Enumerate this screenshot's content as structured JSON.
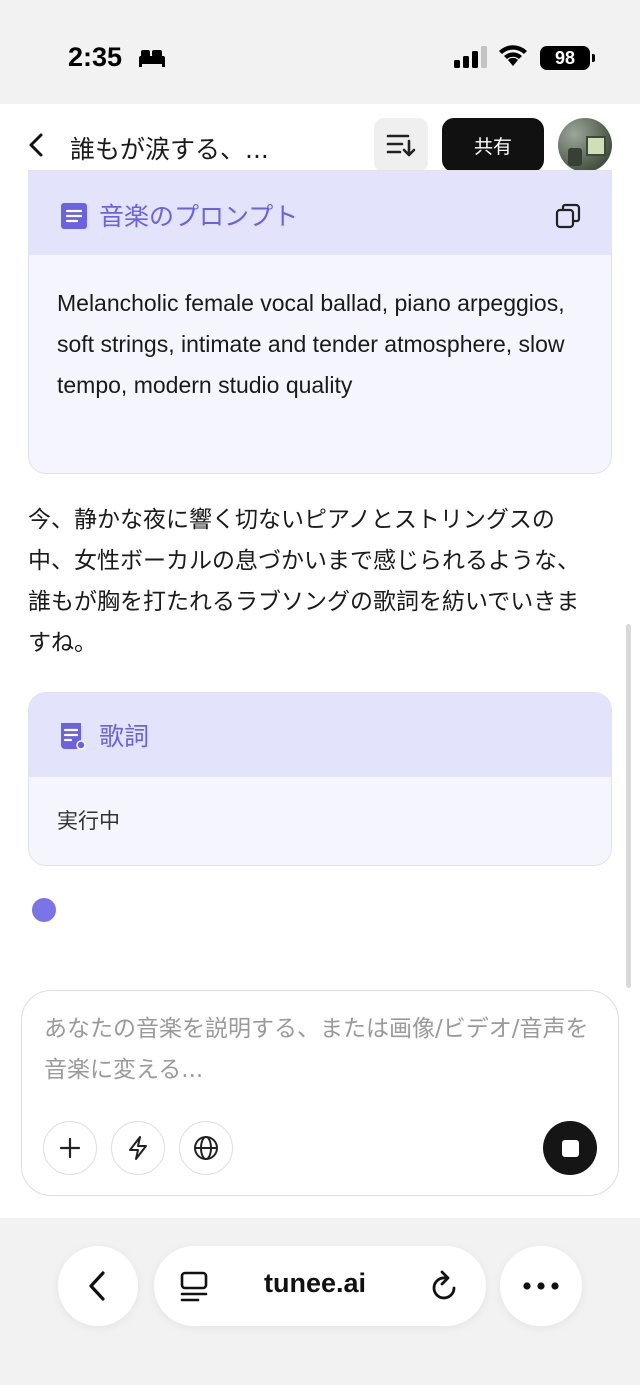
{
  "status_bar": {
    "time": "2:35",
    "battery": "98"
  },
  "header": {
    "title": "誰もが涙する、...",
    "share_label": "共有"
  },
  "prompt_card": {
    "title": "音楽のプロンプト",
    "text": "Melancholic female vocal ballad, piano arpeggios, soft strings, intimate and tender atmosphere, slow tempo, modern studio quality"
  },
  "assistant_message": "今、静かな夜に響く切ないピアノとストリングスの中、女性ボーカルの息づかいまで感じられるような、誰もが胸を打たれるラブソングの歌詞を紡いでいきますね。",
  "lyrics_card": {
    "title": "歌詞",
    "status": "実行中"
  },
  "composer": {
    "placeholder": "あなたの音楽を説明する、または画像/ビデオ/音声を音楽に変える..."
  },
  "browser": {
    "url": "tunee.ai"
  },
  "colors": {
    "accent": "#6a62e0",
    "card_header": "#e3e3fb",
    "dot": "#7b74e6"
  }
}
